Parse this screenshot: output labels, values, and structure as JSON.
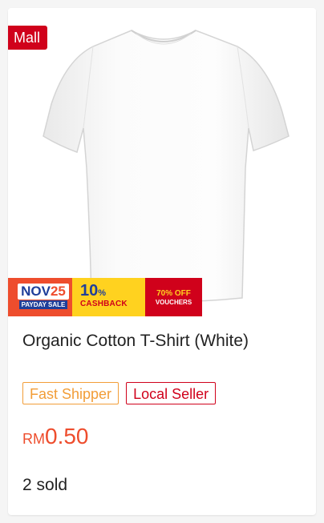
{
  "badge": {
    "mall_label": "Mall"
  },
  "promo": {
    "nov": "NOV",
    "nov_num": "25",
    "payday": "PAYDAY SALE",
    "cashback_pct": "10",
    "cashback_pct_sign": "%",
    "cashback_label": "CASHBACK",
    "voucher_off": "70% OFF",
    "voucher_label": "VOUCHERS"
  },
  "product": {
    "title": "Organic Cotton T-Shirt (White)",
    "tags": [
      "Fast Shipper",
      "Local Seller"
    ],
    "currency": "RM",
    "price": "0.50",
    "sold": "2 sold",
    "image": "white-tshirt"
  },
  "colors": {
    "accent": "#ee4d2d",
    "mall": "#d0011b",
    "fast_shipper": "#f29d38"
  }
}
